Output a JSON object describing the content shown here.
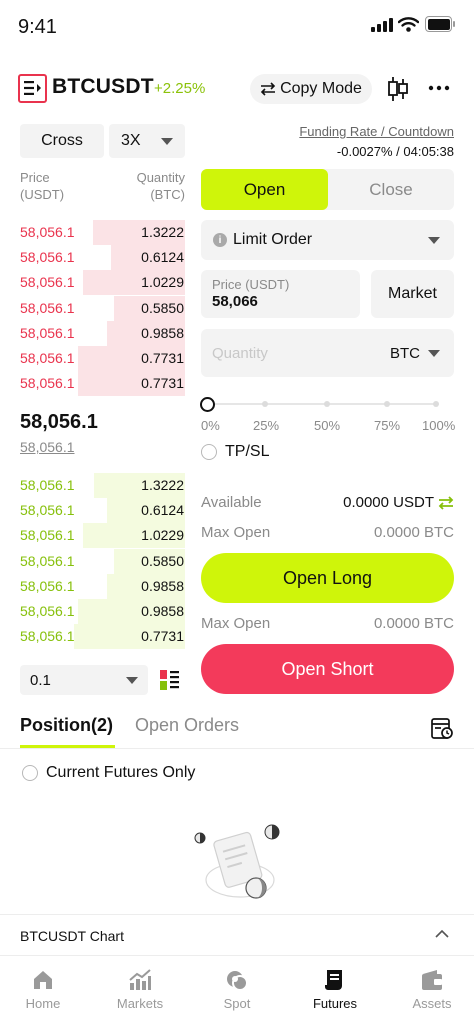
{
  "status_bar": {
    "time": "9:41"
  },
  "header": {
    "pair": "BTCUSDT",
    "change": "+2.25%",
    "copy_mode_label": "Copy Mode",
    "colors": {
      "positive": "#8bc20a",
      "negative": "#e9334d",
      "accent": "#cff50a"
    }
  },
  "left": {
    "margin_mode": "Cross",
    "leverage": "3X",
    "price_header_1": "Price",
    "price_header_2": "(USDT)",
    "qty_header_1": "Quantity",
    "qty_header_2": "(BTC)",
    "asks": [
      {
        "price": "58,056.1",
        "qty": "1.3222",
        "depth": 0.56
      },
      {
        "price": "58,056.1",
        "qty": "0.6124",
        "depth": 0.45
      },
      {
        "price": "58,056.1",
        "qty": "1.0229",
        "depth": 0.62
      },
      {
        "price": "58,056.1",
        "qty": "0.5850",
        "depth": 0.43
      },
      {
        "price": "58,056.1",
        "qty": "0.9858",
        "depth": 0.47
      },
      {
        "price": "58,056.1",
        "qty": "0.7731",
        "depth": 0.65
      },
      {
        "price": "58,056.1",
        "qty": "0.7731",
        "depth": 0.65
      }
    ],
    "last_price": "58,056.1",
    "mark_price": "58,056.1",
    "bids": [
      {
        "price": "58,056.1",
        "qty": "1.3222",
        "depth": 0.55
      },
      {
        "price": "58,056.1",
        "qty": "0.6124",
        "depth": 0.47
      },
      {
        "price": "58,056.1",
        "qty": "1.0229",
        "depth": 0.62
      },
      {
        "price": "58,056.1",
        "qty": "0.5850",
        "depth": 0.43
      },
      {
        "price": "58,056.1",
        "qty": "0.9858",
        "depth": 0.47
      },
      {
        "price": "58,056.1",
        "qty": "0.9858",
        "depth": 0.65
      },
      {
        "price": "58,056.1",
        "qty": "0.7731",
        "depth": 0.67
      }
    ],
    "depth_precision": "0.1"
  },
  "right": {
    "funding_label": "Funding Rate / Countdown",
    "funding_value": "-0.0027% / 04:05:38",
    "tab_open": "Open",
    "tab_close": "Close",
    "order_type": "Limit Order",
    "price_label": "Price (USDT)",
    "price_value": "58,066",
    "market_label": "Market",
    "quantity_placeholder": "Quantity",
    "quantity_unit": "BTC",
    "slider_ticks": [
      "0%",
      "25%",
      "50%",
      "75%",
      "100%"
    ],
    "slider_value": 0,
    "tpsl_label": "TP/SL",
    "available_label": "Available",
    "available_value": "0.0000 USDT",
    "max_open_label": "Max Open",
    "max_open_long_value": "0.0000 BTC",
    "open_long_label": "Open Long",
    "max_open_short_value": "0.0000 BTC",
    "open_short_label": "Open Short"
  },
  "positions": {
    "tab_position": "Position(2)",
    "tab_orders": "Open Orders",
    "current_only_label": "Current Futures Only"
  },
  "chart_bar": {
    "label": "BTCUSDT Chart"
  },
  "nav": {
    "items": [
      {
        "label": "Home",
        "icon": "home-icon"
      },
      {
        "label": "Markets",
        "icon": "markets-icon"
      },
      {
        "label": "Spot",
        "icon": "spot-icon"
      },
      {
        "label": "Futures",
        "icon": "futures-icon"
      },
      {
        "label": "Assets",
        "icon": "wallet-icon"
      }
    ],
    "active": "Futures"
  }
}
